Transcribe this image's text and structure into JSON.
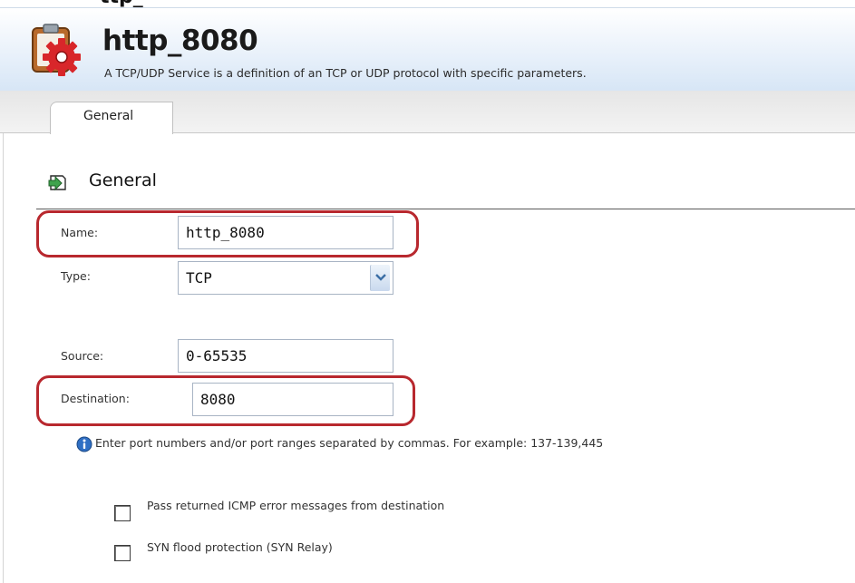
{
  "header": {
    "cropped_top_text": "ttp_",
    "title": "http_8080",
    "subtitle": "A TCP/UDP Service is a definition of an TCP or UDP protocol with specific parameters.",
    "icon": "service-gear-icon"
  },
  "tabs": [
    {
      "label": "General",
      "active": true
    }
  ],
  "section": {
    "title": "General",
    "icon": "edit-arrow-icon"
  },
  "form": {
    "name": {
      "label": "Name:",
      "value": "http_8080"
    },
    "type": {
      "label": "Type:",
      "value": "TCP"
    },
    "source": {
      "label": "Source:",
      "value": "0-65535"
    },
    "destination": {
      "label": "Destination:",
      "value": "8080"
    },
    "hint": "Enter port numbers and/or port ranges separated by commas. For example: 137-139,445",
    "checkboxes": [
      {
        "label": "Pass returned ICMP error messages from destination",
        "checked": false
      },
      {
        "label": "SYN flood protection (SYN Relay)",
        "checked": false
      }
    ]
  },
  "colors": {
    "highlight": "#b8282e",
    "header_gradient_end": "#d7e6f6",
    "field_border": "#a8b4c4"
  }
}
